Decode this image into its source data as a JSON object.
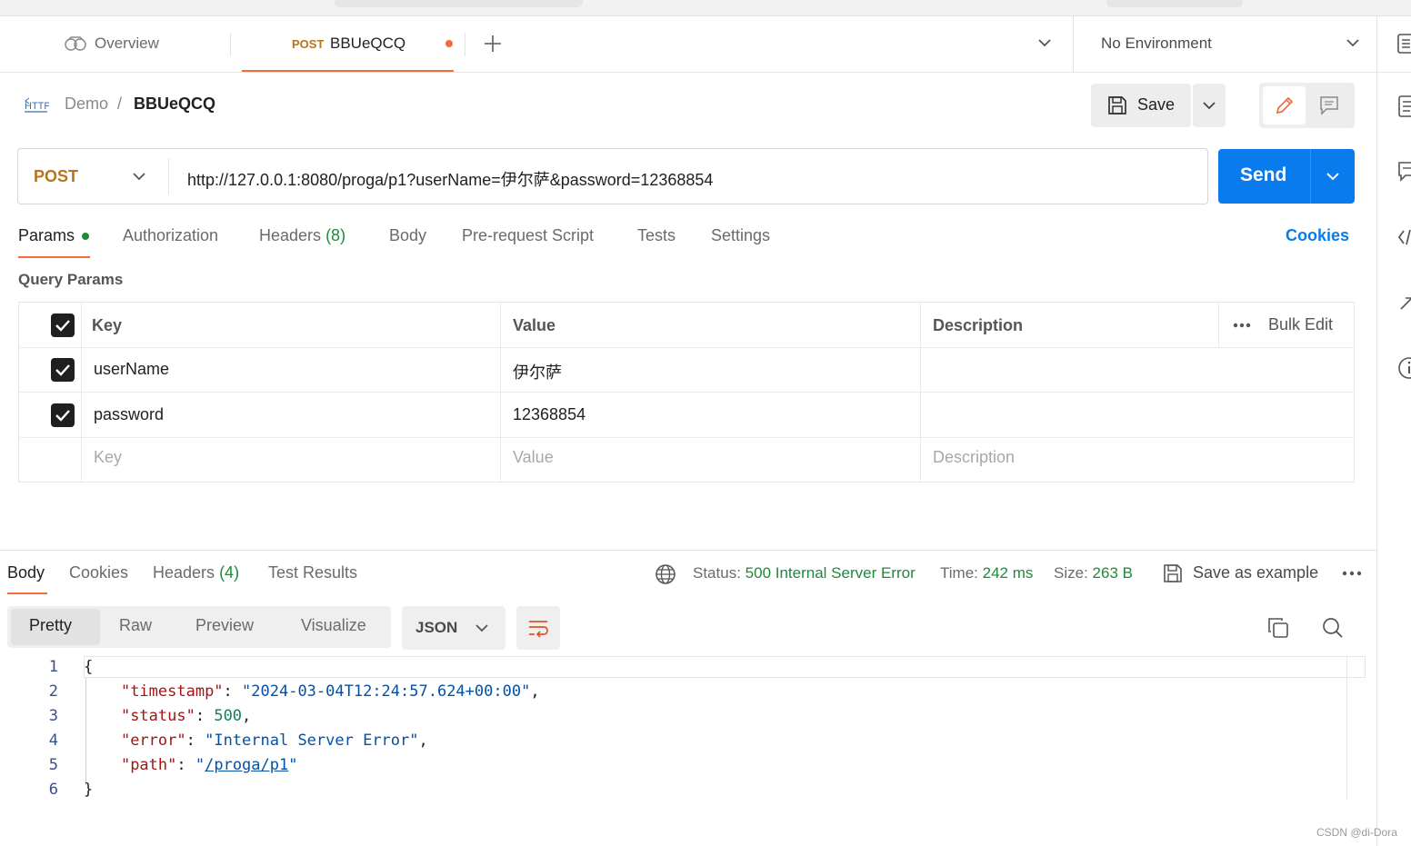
{
  "tabs": {
    "overview_label": "Overview",
    "active_method": "POST",
    "active_name": "BBUeQCQ",
    "environment": "No Environment"
  },
  "breadcrumb": {
    "collection": "Demo",
    "separator": "/",
    "request": "BBUeQCQ"
  },
  "toolbar": {
    "save_label": "Save"
  },
  "request": {
    "method": "POST",
    "url": "http://127.0.0.1:8080/proga/p1?userName=伊尔萨&password=12368854",
    "send_label": "Send"
  },
  "request_tabs": {
    "params": "Params",
    "authorization": "Authorization",
    "headers": "Headers",
    "headers_count": "(8)",
    "body": "Body",
    "prerequest": "Pre-request Script",
    "tests": "Tests",
    "settings": "Settings",
    "cookies": "Cookies"
  },
  "query_params": {
    "title": "Query Params",
    "headers": {
      "key": "Key",
      "value": "Value",
      "description": "Description",
      "bulk_edit": "Bulk Edit"
    },
    "rows": [
      {
        "key": "userName",
        "value": "伊尔萨",
        "checked": true
      },
      {
        "key": "password",
        "value": "12368854",
        "checked": true
      }
    ],
    "placeholders": {
      "key": "Key",
      "value": "Value",
      "description": "Description"
    }
  },
  "response": {
    "tabs": {
      "body": "Body",
      "cookies": "Cookies",
      "headers": "Headers",
      "headers_count": "(4)",
      "test_results": "Test Results"
    },
    "status_label": "Status:",
    "status_value": "500 Internal Server Error",
    "time_label": "Time:",
    "time_value": "242 ms",
    "size_label": "Size:",
    "size_value": "263 B",
    "save_example": "Save as example",
    "views": {
      "pretty": "Pretty",
      "raw": "Raw",
      "preview": "Preview",
      "visualize": "Visualize"
    },
    "format": "JSON",
    "line_numbers": [
      "1",
      "2",
      "3",
      "4",
      "5",
      "6"
    ],
    "json": {
      "open": "{",
      "timestamp_key": "\"timestamp\"",
      "timestamp_value": "\"2024-03-04T12:24:57.624+00:00\"",
      "status_key": "\"status\"",
      "status_value": "500",
      "error_key": "\"error\"",
      "error_value": "\"Internal Server Error\"",
      "path_key": "\"path\"",
      "path_value": "/proga/p1",
      "close": "}"
    }
  },
  "watermark": "CSDN @di-Dora",
  "colors": {
    "accent": "#f26b3a",
    "send": "#097bed",
    "status_ok_text": "#1e8a3a",
    "method": "#b8741a"
  }
}
